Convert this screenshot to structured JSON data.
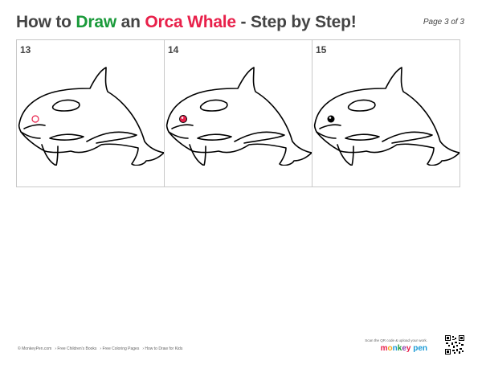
{
  "header": {
    "title_pre": "How to ",
    "title_draw": "Draw",
    "title_mid": " an ",
    "title_orca": "Orca Whale",
    "title_post": " - Step by Step!",
    "page": "Page 3 of 3"
  },
  "panels": [
    {
      "step": "13",
      "eye_style": "red-outline"
    },
    {
      "step": "14",
      "eye_style": "red-filled"
    },
    {
      "step": "15",
      "eye_style": "black-filled"
    }
  ],
  "footer": {
    "links": [
      "© MonkeyPen.com",
      "› Free Children's Books",
      "› Free Coloring Pages",
      "› How to Draw for Kids"
    ],
    "scan_text": "Scan the QR code & upload your work.",
    "brand": "monkey pen"
  },
  "colors": {
    "green": "#1a9a3a",
    "red": "#e8204a",
    "text": "#444444",
    "border": "#c8c8c8"
  }
}
